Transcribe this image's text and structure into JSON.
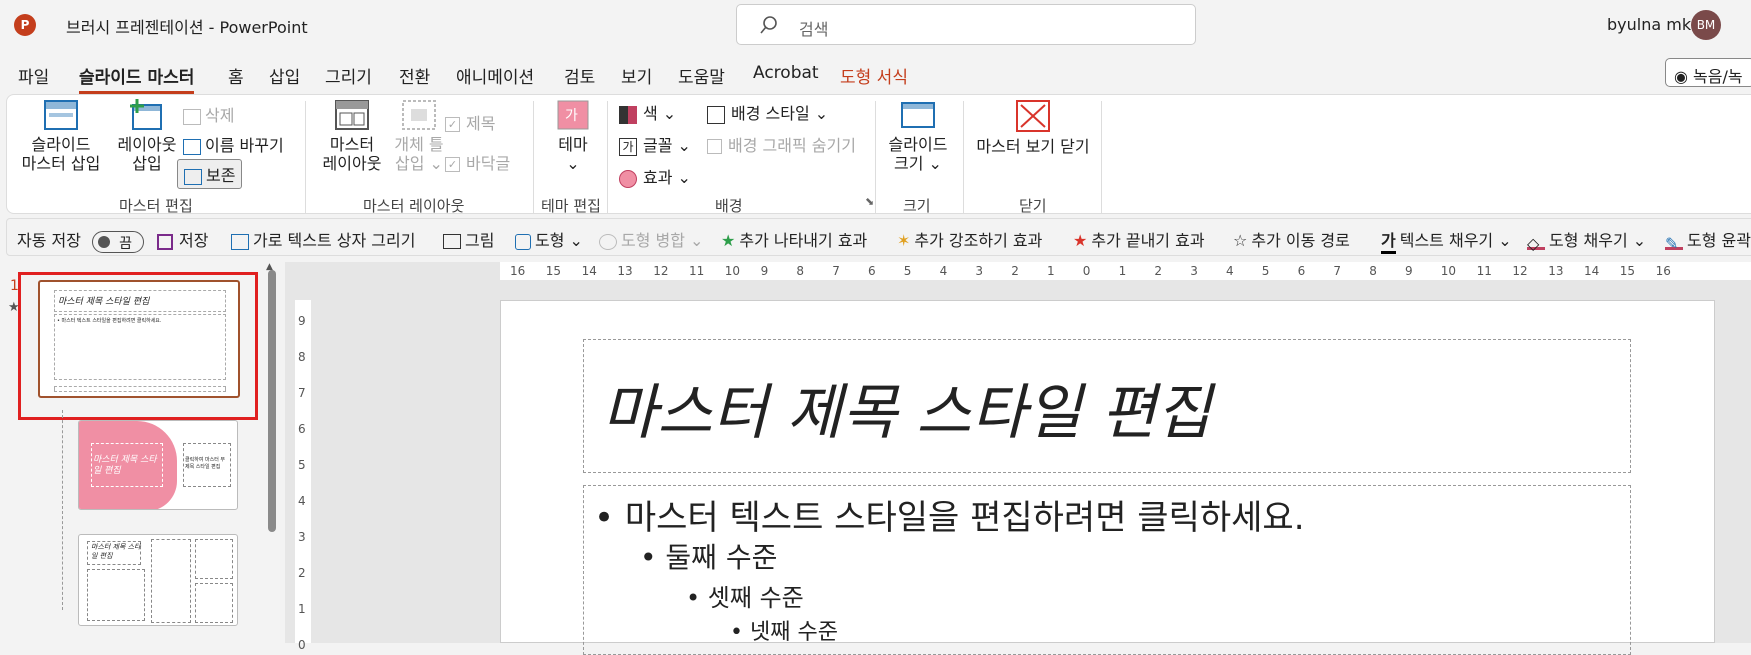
{
  "app": {
    "logo_letter": "P",
    "title": "브러시 프레젠테이션  -  PowerPoint",
    "search_placeholder": "검색",
    "user_name": "byulna mk",
    "avatar_initials": "BM"
  },
  "menu": {
    "tabs": [
      "파일",
      "슬라이드 마스터",
      "홈",
      "삽입",
      "그리기",
      "전환",
      "애니메이션",
      "검토",
      "보기",
      "도움말",
      "Acrobat",
      "도형 서식"
    ],
    "record_label": "◉ 녹음/녹"
  },
  "ribbon": {
    "insert_master": [
      "슬라이드",
      "마스터 삽입"
    ],
    "insert_layout": [
      "레이아웃",
      "삽입"
    ],
    "delete": "삭제",
    "rename": "이름 바꾸기",
    "preserve": "보존",
    "group_master_edit": "마스터 편집",
    "master_layout": [
      "마스터",
      "레이아웃"
    ],
    "insert_placeholder": [
      "개체 틀",
      "삽입 ⌄"
    ],
    "title_check": "제목",
    "footer_check": "바닥글",
    "group_master_layout": "마스터 레이아웃",
    "theme": [
      "테마",
      "⌄"
    ],
    "group_theme_edit": "테마 편집",
    "colors": "색 ⌄",
    "fonts": "글꼴 ⌄",
    "effects": "효과 ⌄",
    "bg_styles": "배경 스타일 ⌄",
    "hide_bg": "배경 그래픽 숨기기",
    "group_background": "배경",
    "slide_size": [
      "슬라이드",
      "크기 ⌄"
    ],
    "group_size": "크기",
    "close_master": "마스터 보기 닫기",
    "group_close": "닫기",
    "accent_colors": {
      "primary": "#c43e1c",
      "pink": "#f08fa4",
      "thumb_sel": "#e02020"
    }
  },
  "qat": {
    "autosave": "자동 저장",
    "autosave_state": "끔",
    "save": "저장",
    "draw_textbox": "가로 텍스트 상자 그리기",
    "picture": "그림",
    "shape": "도형 ⌄",
    "merge_shapes": "도형 병합 ⌄",
    "add_entrance": "추가 나타내기 효과",
    "add_emphasis": "추가 강조하기 효과",
    "add_exit": "추가 끝내기 효과",
    "add_motion": "추가 이동 경로",
    "text_fill": "텍스트 채우기 ⌄",
    "shape_fill": "도형 채우기 ⌄",
    "shape_outline": "도형 윤곽"
  },
  "thumbnails": {
    "slide_number": "1",
    "master_title": "마스터 제목 스타일 편집",
    "master_body": "• 마스터 텍스트 스타일을 편집하려면 클릭하세요.",
    "thumb2_title": "마스터 제목 스타일 편집",
    "thumb2_side": "클릭하여 마스터 부제목 스타일 편집",
    "thumb3_title": "마스터 제목 스타일 편집"
  },
  "ruler": {
    "h_ticks": [
      "16",
      "15",
      "14",
      "13",
      "12",
      "11",
      "10",
      "9",
      "8",
      "7",
      "6",
      "5",
      "4",
      "3",
      "2",
      "1",
      "0",
      "1",
      "2",
      "3",
      "4",
      "5",
      "6",
      "7",
      "8",
      "9",
      "10",
      "11",
      "12",
      "13",
      "14",
      "15",
      "16"
    ],
    "v_ticks": [
      "9",
      "8",
      "7",
      "6",
      "5",
      "4",
      "3",
      "2",
      "1",
      "0"
    ]
  },
  "slide": {
    "title": "마스터 제목 스타일 편집",
    "bullets": [
      "마스터 텍스트 스타일을 편집하려면 클릭하세요.",
      "둘째 수준",
      "셋째 수준",
      "넷째 수준"
    ]
  }
}
